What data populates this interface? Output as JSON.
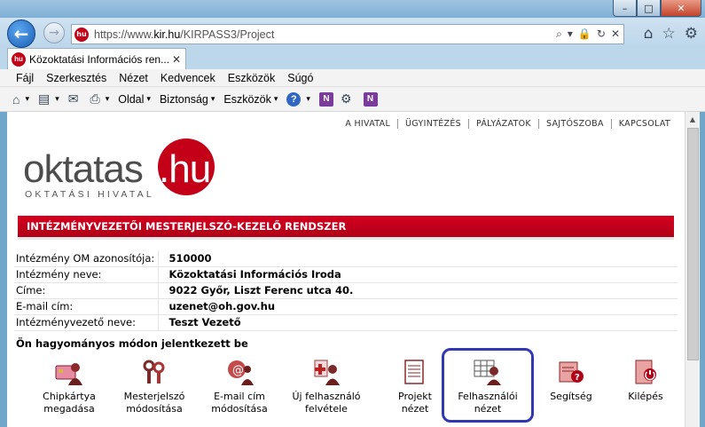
{
  "browser": {
    "url_prefix": "https://www.",
    "url_domain": "kir.hu",
    "url_path": "/KIRPASS3/Project",
    "tab_title": "Közoktatási Információs ren...",
    "favicon_text": "hu",
    "back_glyph": "←",
    "forward_glyph": "→",
    "window_buttons": {
      "minimize": "–",
      "maximize": "□",
      "close": "✕"
    },
    "tab_close": "✕",
    "address_tools": [
      "⌕",
      "▾",
      "🔒",
      "↻",
      "✕"
    ],
    "right_icons": [
      "⌂",
      "☆",
      "⚙"
    ]
  },
  "menu": {
    "items": [
      "Fájl",
      "Szerkesztés",
      "Nézet",
      "Kedvencek",
      "Eszközök",
      "Súgó"
    ]
  },
  "commandbar": {
    "home_glyph": "⌂",
    "rss_glyph": "▤",
    "mail_glyph": "✉",
    "print_glyph": "⎙",
    "page_label": "Oldal",
    "security_label": "Biztonság",
    "tools_label": "Eszközök",
    "help_glyph": "?",
    "onenote_glyph": "N",
    "dropdown_glyph": "▾"
  },
  "site": {
    "topnav": [
      "A HIVATAL",
      "ÜGYINTÉZÉS",
      "PÁLYÁZATOK",
      "SAJTÓSZOBA",
      "KAPCSOLAT"
    ],
    "logo_main": "oktatas",
    "logo_hu": ".hu",
    "logo_sub": "OKTATÁSI HIVATAL",
    "banner": "INTÉZMÉNYVEZETŐI MESTERJELSZÓ-KEZELŐ RENDSZER"
  },
  "institution": {
    "rows": [
      {
        "label": "Intézmény OM azonosítója:",
        "value": "510000"
      },
      {
        "label": "Intézmény neve:",
        "value": "Közoktatási Információs Iroda"
      },
      {
        "label": "Címe:",
        "value": "9022 Győr, Liszt Ferenc utca 40."
      },
      {
        "label": "E-mail cím:",
        "value": "uzenet@oh.gov.hu"
      },
      {
        "label": "Intézményvezető neve:",
        "value": "Teszt Vezető"
      }
    ]
  },
  "login_note": "Ön hagyományos módon jelentkezett be",
  "actions": [
    {
      "line1": "Chipkártya",
      "line2": "megadása"
    },
    {
      "line1": "Mesterjelszó",
      "line2": "módosítása"
    },
    {
      "line1": "E-mail cím",
      "line2": "módosítása"
    },
    {
      "line1": "Új felhasználó",
      "line2": "felvétele"
    },
    {
      "line1": "Projekt",
      "line2": "nézet"
    },
    {
      "line1": "Felhasználói",
      "line2": "nézet"
    },
    {
      "line1": "Segítség",
      "line2": ""
    },
    {
      "line1": "Kilépés",
      "line2": ""
    }
  ],
  "colors": {
    "brand_red": "#c40018",
    "selection_blue": "#3239b0"
  }
}
